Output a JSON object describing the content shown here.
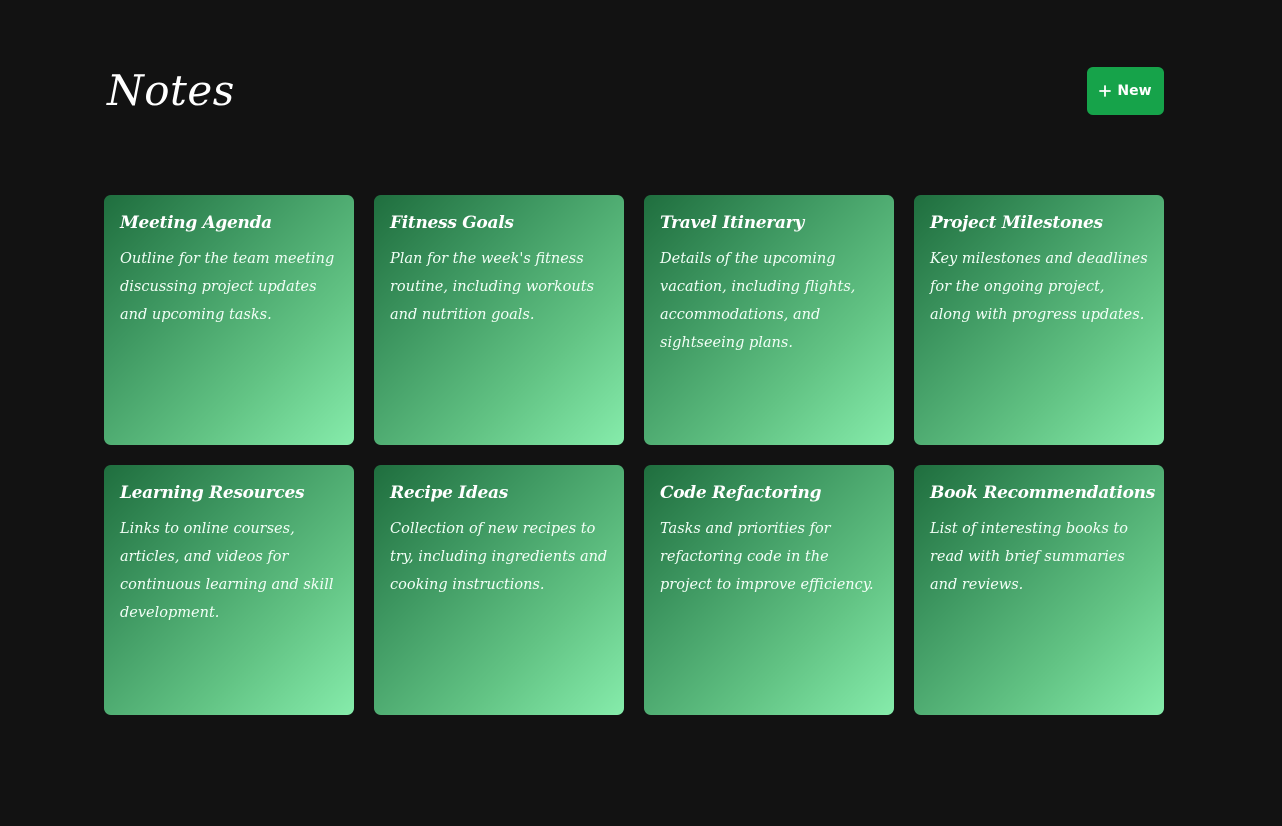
{
  "header": {
    "title": "Notes",
    "new_button": {
      "label": "New",
      "icon": "plus-icon",
      "color": "#16a34a"
    }
  },
  "theme": {
    "background": "#121212",
    "card_gradient": [
      "#1f6e3e",
      "#86ecab"
    ]
  },
  "notes": [
    {
      "title": "Meeting Agenda",
      "body": "Outline for the team meeting discussing project updates and upcoming tasks."
    },
    {
      "title": "Fitness Goals",
      "body": "Plan for the week's fitness routine, including workouts and nutrition goals."
    },
    {
      "title": "Travel Itinerary",
      "body": "Details of the upcoming vacation, including flights, accommodations, and sightseeing plans."
    },
    {
      "title": "Project Milestones",
      "body": "Key milestones and deadlines for the ongoing project, along with progress updates."
    },
    {
      "title": "Learning Resources",
      "body": "Links to online courses, articles, and videos for continuous learning and skill development."
    },
    {
      "title": "Recipe Ideas",
      "body": "Collection of new recipes to try, including ingredients and cooking instructions."
    },
    {
      "title": "Code Refactoring",
      "body": "Tasks and priorities for refactoring code in the project to improve efficiency."
    },
    {
      "title": "Book Recommendations",
      "body": "List of interesting books to read with brief summaries and reviews."
    }
  ]
}
